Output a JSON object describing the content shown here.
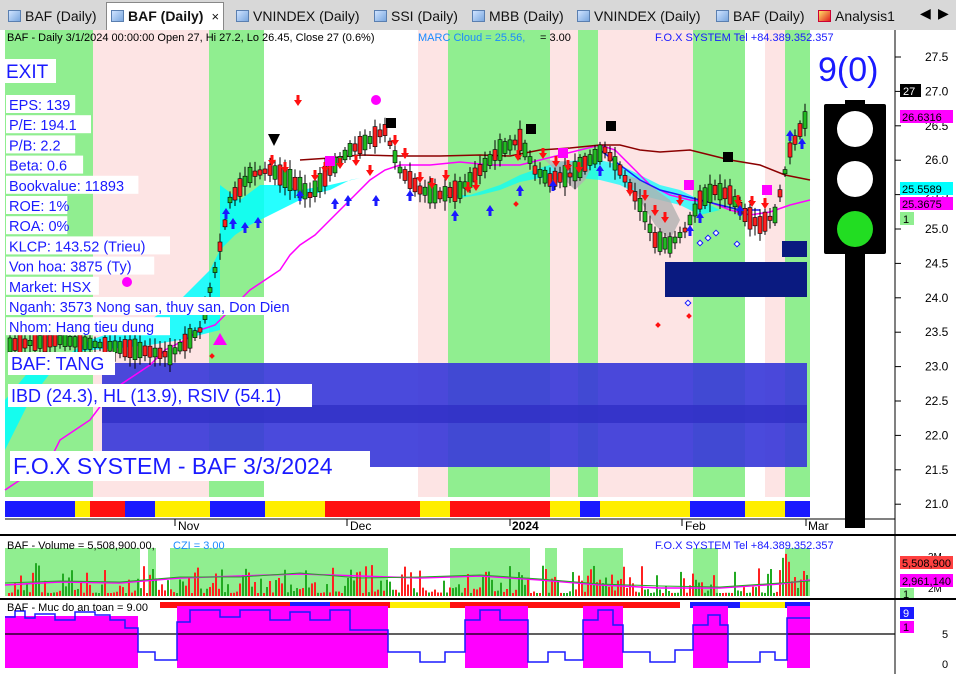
{
  "tabs": [
    {
      "label": "BAF (Daily)",
      "active": false
    },
    {
      "label": "BAF (Daily)",
      "active": true
    },
    {
      "label": "VNINDEX (Daily)",
      "active": false
    },
    {
      "label": "SSI (Daily)",
      "active": false
    },
    {
      "label": "MBB (Daily)",
      "active": false
    },
    {
      "label": "VNINDEX (Daily)",
      "active": false
    },
    {
      "label": "BAF (Daily)",
      "active": false
    },
    {
      "label": "Analysis1",
      "active": false
    }
  ],
  "tab_close": "×",
  "tab_prev": "◀",
  "tab_next": "▶",
  "main": {
    "header_left": "BAF - Daily 3/1/2024 00:00:00 Open 27, Hi 27.2, Lo 26.45, Close 27 (0.6%)",
    "header_marc": "MARC Cloud = 25.56,",
    "header_eq": "= 3.00",
    "header_right": "F.O.X SYSTEM Tel +84.389.352.357",
    "exit_label": "EXIT",
    "info": [
      "EPS: 139",
      "P/E: 194.1",
      "P/B: 2.2",
      "Beta: 0.6",
      "Bookvalue: 11893",
      "ROE: 1%",
      "ROA: 0%",
      "KLCP: 143.52 (Trieu)",
      "Von hoa: 3875 (Ty)",
      "Market: HSX",
      "Nganh: 3573 Nong san, thuy san, Don Dien",
      "Nhom: Hang tieu dung"
    ],
    "signal": "BAF: TANG",
    "indicators": "IBD (24.3), HL (13.9), RSIV (54.1)",
    "watermark": "F.O.X SYSTEM - BAF 3/3/2024",
    "score": "9(0)",
    "y_ticks": [
      "27.5",
      "27.0",
      "26.5",
      "26.0",
      "25.5",
      "25.0",
      "24.5",
      "24.0",
      "23.5",
      "23.0",
      "22.5",
      "22.0",
      "21.5",
      "21.0"
    ],
    "x_ticks": [
      "Nov",
      "Dec",
      "2024",
      "Feb",
      "Mar"
    ],
    "price_tags": [
      {
        "text": "27",
        "bg": "#000000",
        "fg": "#ffffff"
      },
      {
        "text": "26.6316",
        "bg": "#ff00ff",
        "fg": "#000000"
      },
      {
        "text": "25.5589",
        "bg": "#00ffff",
        "fg": "#000000"
      },
      {
        "text": "25.3675",
        "bg": "#ff00ff",
        "fg": "#000000"
      },
      {
        "text": "1",
        "bg": "#90ee90",
        "fg": "#000000"
      }
    ]
  },
  "volume": {
    "header_left": "BAF - Volume = 5,508,900.00,",
    "header_czi": "CZI = 3.00",
    "header_right": "F.O.X SYSTEM Tel +84.389.352.357",
    "y_ticks": [
      "3M",
      "2M"
    ],
    "tags": [
      {
        "text": "5,508,900",
        "bg": "#ff4040",
        "fg": "#000000"
      },
      {
        "text": "2,961,140",
        "bg": "#ff00ff",
        "fg": "#000000"
      },
      {
        "text": "1",
        "bg": "#90ee90",
        "fg": "#000000"
      }
    ]
  },
  "safety": {
    "header": "BAF - Muc do an toan = 9.00",
    "y_ticks": [
      "5",
      "0"
    ],
    "tags": [
      {
        "text": "9",
        "bg": "#1a1aff",
        "fg": "#ffffff"
      },
      {
        "text": "1",
        "bg": "#ff00ff",
        "fg": "#000000"
      }
    ]
  },
  "colors": {
    "green_band": "#90ee90",
    "pink_band": "#fde4e4",
    "cloud": "#00ffff",
    "up_arrow": "#1a1aff",
    "down_arrow": "#ff1010",
    "navy_box": "#0a1a80",
    "panel_box": "#3b3bd9",
    "magenta": "#ff00ff"
  }
}
